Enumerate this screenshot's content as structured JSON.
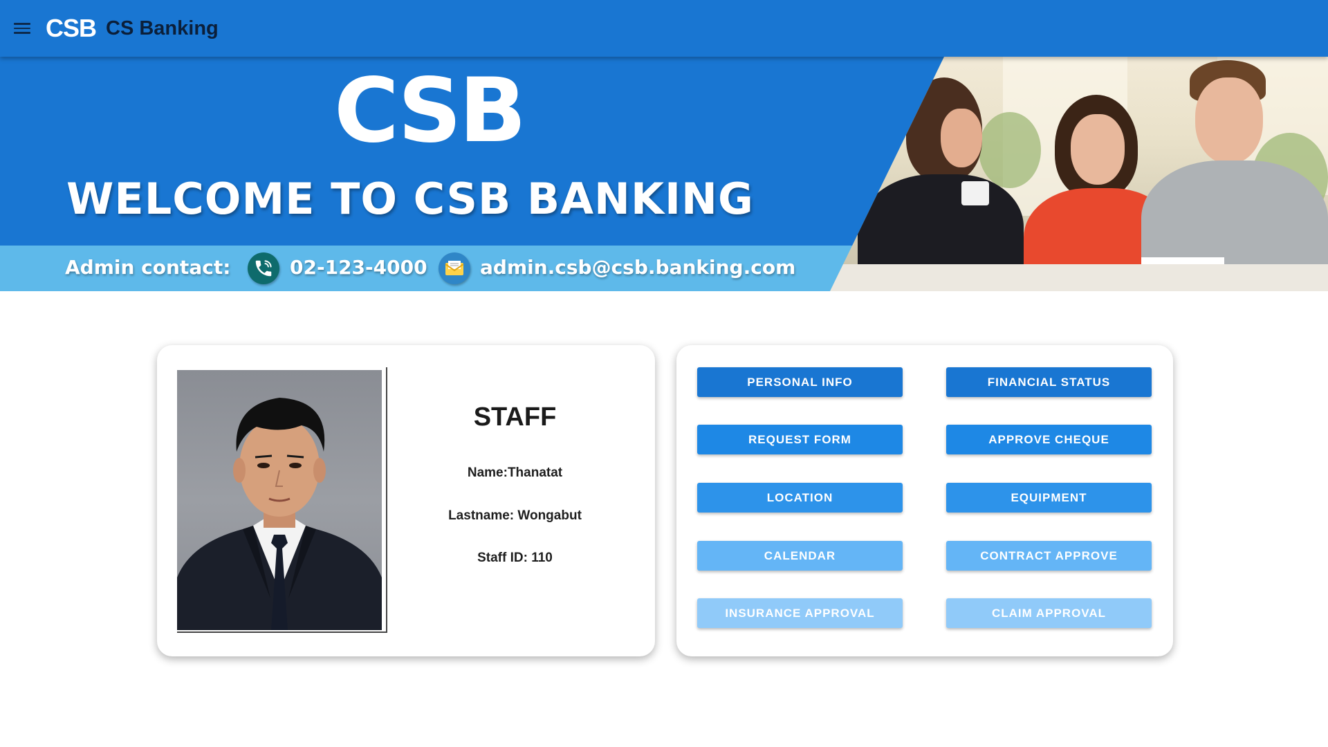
{
  "app": {
    "logo": "CSB",
    "name": "CS Banking"
  },
  "banner": {
    "logo": "CSB",
    "welcome": "WELCOME TO CSB BANKING",
    "contact_label": "Admin contact:",
    "phone": "02-123-4000",
    "email": "admin.csb@csb.banking.com"
  },
  "profile": {
    "role": "STAFF",
    "name": "Name:Thanatat",
    "lastname": "Lastname: Wongabut",
    "staff_id": "Staff ID: 110"
  },
  "menu": {
    "personal_info": "PERSONAL INFO",
    "financial_status": "FINANCIAL STATUS",
    "request_form": "REQUEST FORM",
    "approve_cheque": "APPROVE CHEQUE",
    "location": "LOCATION",
    "equipment": "EQUIPMENT",
    "calendar": "CALENDAR",
    "contract_approve": "CONTRACT APPROVE",
    "insurance_approval": "INSURANCE APPROVAL",
    "claim_approval": "CLAIM APPROVAL"
  },
  "colors": {
    "primary": "#1976d2",
    "banner_stripe": "#5eb9ea",
    "button_shades": [
      "#1976d2",
      "#1e88e5",
      "#2d93ea",
      "#64b5f6",
      "#90caf9"
    ]
  },
  "icons": {
    "menu": "hamburger-menu-icon",
    "phone": "phone-icon",
    "email": "envelope-icon"
  }
}
